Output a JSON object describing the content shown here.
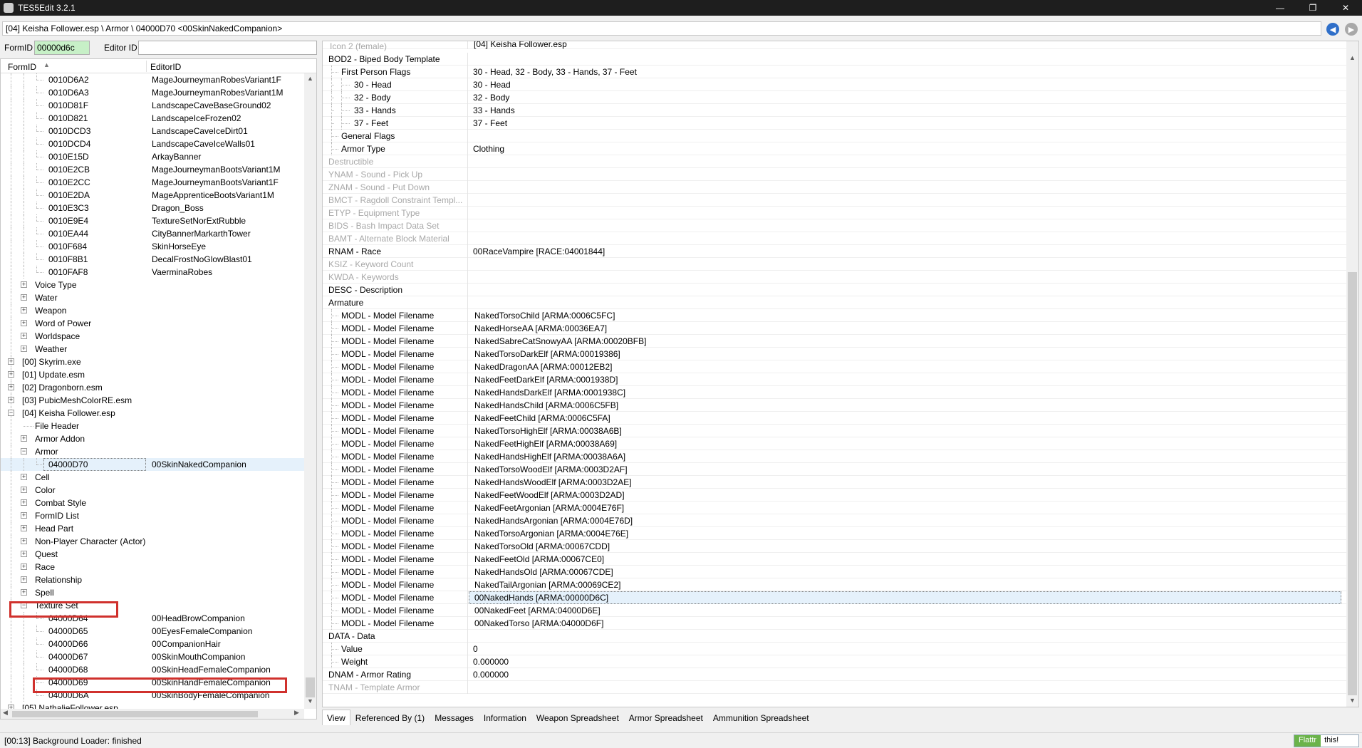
{
  "window": {
    "title": "TES5Edit 3.2.1",
    "controls": [
      "—",
      "❐",
      "✕"
    ]
  },
  "path": "[04] Keisha Follower.esp \\ Armor \\ 04000D70 <00SkinNakedCompanion>",
  "filter": {
    "formid_label": "FormID",
    "formid_value": "00000d6c",
    "editorid_label": "Editor ID",
    "editorid_value": ""
  },
  "tree": {
    "col_formid": "FormID",
    "col_editorid": "EditorID",
    "rows": [
      {
        "level": 3,
        "name": "0010D6A2",
        "editor": "MageJourneymanRobesVariant1F"
      },
      {
        "level": 3,
        "name": "0010D6A3",
        "editor": "MageJourneymanRobesVariant1M"
      },
      {
        "level": 3,
        "name": "0010D81F",
        "editor": "LandscapeCaveBaseGround02"
      },
      {
        "level": 3,
        "name": "0010D821",
        "editor": "LandscapeIceFrozen02"
      },
      {
        "level": 3,
        "name": "0010DCD3",
        "editor": "LandscapeCaveIceDirt01"
      },
      {
        "level": 3,
        "name": "0010DCD4",
        "editor": "LandscapeCaveIceWalls01"
      },
      {
        "level": 3,
        "name": "0010E15D",
        "editor": "ArkayBanner"
      },
      {
        "level": 3,
        "name": "0010E2CB",
        "editor": "MageJourneymanBootsVariant1M"
      },
      {
        "level": 3,
        "name": "0010E2CC",
        "editor": "MageJourneymanBootsVariant1F"
      },
      {
        "level": 3,
        "name": "0010E2DA",
        "editor": "MageApprenticeBootsVariant1M"
      },
      {
        "level": 3,
        "name": "0010E3C3",
        "editor": "Dragon_Boss"
      },
      {
        "level": 3,
        "name": "0010E9E4",
        "editor": "TextureSetNorExtRubble"
      },
      {
        "level": 3,
        "name": "0010EA44",
        "editor": "CityBannerMarkarthTower"
      },
      {
        "level": 3,
        "name": "0010F684",
        "editor": "SkinHorseEye"
      },
      {
        "level": 3,
        "name": "0010F8B1",
        "editor": "DecalFrostNoGlowBlast01"
      },
      {
        "level": 3,
        "name": "0010FAF8",
        "editor": "VaerminaRobes"
      },
      {
        "level": 2,
        "name": "Voice Type",
        "editor": "",
        "exp": "+"
      },
      {
        "level": 2,
        "name": "Water",
        "editor": "",
        "exp": "+"
      },
      {
        "level": 2,
        "name": "Weapon",
        "editor": "",
        "exp": "+"
      },
      {
        "level": 2,
        "name": "Word of Power",
        "editor": "",
        "exp": "+"
      },
      {
        "level": 2,
        "name": "Worldspace",
        "editor": "",
        "exp": "+"
      },
      {
        "level": 2,
        "name": "Weather",
        "editor": "",
        "exp": "+"
      },
      {
        "level": 1,
        "name": "[00] Skyrim.exe",
        "editor": "",
        "exp": "+"
      },
      {
        "level": 1,
        "name": "[01] Update.esm",
        "editor": "",
        "exp": "+"
      },
      {
        "level": 1,
        "name": "[02] Dragonborn.esm",
        "editor": "",
        "exp": "+"
      },
      {
        "level": 1,
        "name": "[03] PubicMeshColorRE.esm",
        "editor": "",
        "exp": "+"
      },
      {
        "level": 1,
        "name": "[04] Keisha Follower.esp",
        "editor": "",
        "exp": "−"
      },
      {
        "level": 2,
        "name": "File Header",
        "editor": ""
      },
      {
        "level": 2,
        "name": "Armor Addon",
        "editor": "",
        "exp": "+"
      },
      {
        "level": 2,
        "name": "Armor",
        "editor": "",
        "exp": "−"
      },
      {
        "level": 3,
        "name": "04000D70",
        "editor": "00SkinNakedCompanion",
        "selected": true
      },
      {
        "level": 2,
        "name": "Cell",
        "editor": "",
        "exp": "+"
      },
      {
        "level": 2,
        "name": "Color",
        "editor": "",
        "exp": "+"
      },
      {
        "level": 2,
        "name": "Combat Style",
        "editor": "",
        "exp": "+"
      },
      {
        "level": 2,
        "name": "FormID List",
        "editor": "",
        "exp": "+"
      },
      {
        "level": 2,
        "name": "Head Part",
        "editor": "",
        "exp": "+"
      },
      {
        "level": 2,
        "name": "Non-Player Character (Actor)",
        "editor": "",
        "exp": "+"
      },
      {
        "level": 2,
        "name": "Quest",
        "editor": "",
        "exp": "+"
      },
      {
        "level": 2,
        "name": "Race",
        "editor": "",
        "exp": "+"
      },
      {
        "level": 2,
        "name": "Relationship",
        "editor": "",
        "exp": "+"
      },
      {
        "level": 2,
        "name": "Spell",
        "editor": "",
        "exp": "+"
      },
      {
        "level": 2,
        "name": "Texture Set",
        "editor": "",
        "exp": "−"
      },
      {
        "level": 3,
        "name": "04000D64",
        "editor": "00HeadBrowCompanion"
      },
      {
        "level": 3,
        "name": "04000D65",
        "editor": "00EyesFemaleCompanion"
      },
      {
        "level": 3,
        "name": "04000D66",
        "editor": "00CompanionHair"
      },
      {
        "level": 3,
        "name": "04000D67",
        "editor": "00SkinMouthCompanion"
      },
      {
        "level": 3,
        "name": "04000D68",
        "editor": "00SkinHeadFemaleCompanion"
      },
      {
        "level": 3,
        "name": "04000D69",
        "editor": "00SkinHandFemaleCompanion"
      },
      {
        "level": 3,
        "name": "04000D6A",
        "editor": "00SkinBodyFemaleCompanion"
      },
      {
        "level": 1,
        "name": "[05] NathalieFollower.esp",
        "editor": "",
        "exp": "+"
      }
    ]
  },
  "record": {
    "header_value": "[04] Keisha Follower.esp",
    "clipped_label": "Icon 2 (female)",
    "rows": [
      {
        "indent": 0,
        "label": "BOD2 - Biped Body Template",
        "value": ""
      },
      {
        "indent": 1,
        "label": "First Person Flags",
        "value": "30 - Head, 32 - Body, 33 - Hands, 37 - Feet"
      },
      {
        "indent": 2,
        "label": "30 - Head",
        "value": "30 - Head"
      },
      {
        "indent": 2,
        "label": "32 - Body",
        "value": "32 - Body"
      },
      {
        "indent": 2,
        "label": "33 - Hands",
        "value": "33 - Hands"
      },
      {
        "indent": 2,
        "label": "37 - Feet",
        "value": "37 - Feet"
      },
      {
        "indent": 1,
        "label": "General Flags",
        "value": ""
      },
      {
        "indent": 1,
        "label": "Armor Type",
        "value": "Clothing"
      },
      {
        "indent": 0,
        "label": "Destructible",
        "value": "",
        "disabled": true
      },
      {
        "indent": 0,
        "label": "YNAM - Sound - Pick Up",
        "value": "",
        "disabled": true
      },
      {
        "indent": 0,
        "label": "ZNAM - Sound - Put Down",
        "value": "",
        "disabled": true
      },
      {
        "indent": 0,
        "label": "BMCT - Ragdoll Constraint Templ...",
        "value": "",
        "disabled": true
      },
      {
        "indent": 0,
        "label": "ETYP - Equipment Type",
        "value": "",
        "disabled": true
      },
      {
        "indent": 0,
        "label": "BIDS - Bash Impact Data Set",
        "value": "",
        "disabled": true
      },
      {
        "indent": 0,
        "label": "BAMT - Alternate Block Material",
        "value": "",
        "disabled": true
      },
      {
        "indent": 0,
        "label": "RNAM - Race",
        "value": "00RaceVampire [RACE:04001844]"
      },
      {
        "indent": 0,
        "label": "KSIZ - Keyword Count",
        "value": "",
        "disabled": true
      },
      {
        "indent": 0,
        "label": "KWDA - Keywords",
        "value": "",
        "disabled": true
      },
      {
        "indent": 0,
        "label": "DESC - Description",
        "value": ""
      },
      {
        "indent": 0,
        "label": "Armature",
        "value": ""
      },
      {
        "indent": 1,
        "label": "MODL - Model Filename",
        "value": "NakedTorsoChild [ARMA:0006C5FC]"
      },
      {
        "indent": 1,
        "label": "MODL - Model Filename",
        "value": "NakedHorseAA [ARMA:00036EA7]"
      },
      {
        "indent": 1,
        "label": "MODL - Model Filename",
        "value": "NakedSabreCatSnowyAA [ARMA:00020BFB]"
      },
      {
        "indent": 1,
        "label": "MODL - Model Filename",
        "value": "NakedTorsoDarkElf [ARMA:00019386]"
      },
      {
        "indent": 1,
        "label": "MODL - Model Filename",
        "value": "NakedDragonAA [ARMA:00012EB2]"
      },
      {
        "indent": 1,
        "label": "MODL - Model Filename",
        "value": "NakedFeetDarkElf [ARMA:0001938D]"
      },
      {
        "indent": 1,
        "label": "MODL - Model Filename",
        "value": "NakedHandsDarkElf [ARMA:0001938C]"
      },
      {
        "indent": 1,
        "label": "MODL - Model Filename",
        "value": "NakedHandsChild [ARMA:0006C5FB]"
      },
      {
        "indent": 1,
        "label": "MODL - Model Filename",
        "value": "NakedFeetChild [ARMA:0006C5FA]"
      },
      {
        "indent": 1,
        "label": "MODL - Model Filename",
        "value": "NakedTorsoHighElf [ARMA:00038A6B]"
      },
      {
        "indent": 1,
        "label": "MODL - Model Filename",
        "value": "NakedFeetHighElf [ARMA:00038A69]"
      },
      {
        "indent": 1,
        "label": "MODL - Model Filename",
        "value": "NakedHandsHighElf [ARMA:00038A6A]"
      },
      {
        "indent": 1,
        "label": "MODL - Model Filename",
        "value": "NakedTorsoWoodElf [ARMA:0003D2AF]"
      },
      {
        "indent": 1,
        "label": "MODL - Model Filename",
        "value": "NakedHandsWoodElf [ARMA:0003D2AE]"
      },
      {
        "indent": 1,
        "label": "MODL - Model Filename",
        "value": "NakedFeetWoodElf [ARMA:0003D2AD]"
      },
      {
        "indent": 1,
        "label": "MODL - Model Filename",
        "value": "NakedFeetArgonian [ARMA:0004E76F]"
      },
      {
        "indent": 1,
        "label": "MODL - Model Filename",
        "value": "NakedHandsArgonian [ARMA:0004E76D]"
      },
      {
        "indent": 1,
        "label": "MODL - Model Filename",
        "value": "NakedTorsoArgonian [ARMA:0004E76E]"
      },
      {
        "indent": 1,
        "label": "MODL - Model Filename",
        "value": "NakedTorsoOld [ARMA:00067CDD]"
      },
      {
        "indent": 1,
        "label": "MODL - Model Filename",
        "value": "NakedFeetOld [ARMA:00067CE0]"
      },
      {
        "indent": 1,
        "label": "MODL - Model Filename",
        "value": "NakedHandsOld [ARMA:00067CDE]"
      },
      {
        "indent": 1,
        "label": "MODL - Model Filename",
        "value": "NakedTailArgonian [ARMA:00069CE2]"
      },
      {
        "indent": 1,
        "label": "MODL - Model Filename",
        "value": "00NakedHands [ARMA:00000D6C]",
        "selected": true
      },
      {
        "indent": 1,
        "label": "MODL - Model Filename",
        "value": "00NakedFeet [ARMA:04000D6E]"
      },
      {
        "indent": 1,
        "label": "MODL - Model Filename",
        "value": "00NakedTorso [ARMA:04000D6F]"
      },
      {
        "indent": 0,
        "label": "DATA - Data",
        "value": ""
      },
      {
        "indent": 1,
        "label": "Value",
        "value": "0"
      },
      {
        "indent": 1,
        "label": "Weight",
        "value": "0.000000"
      },
      {
        "indent": 0,
        "label": "DNAM - Armor Rating",
        "value": "0.000000"
      },
      {
        "indent": 0,
        "label": "TNAM - Template Armor",
        "value": "",
        "disabled": true
      }
    ]
  },
  "tabs": [
    "View",
    "Referenced By (1)",
    "Messages",
    "Information",
    "Weapon Spreadsheet",
    "Armor Spreadsheet",
    "Ammunition Spreadsheet"
  ],
  "active_tab": "View",
  "status": "[00:13] Background Loader: finished",
  "flattr": {
    "left": "Flattr",
    "right": "this!"
  },
  "colors": {
    "highlight_red": "#d0312d",
    "formid_green": "#c7f0c7",
    "selection": "#e5f1fb"
  }
}
